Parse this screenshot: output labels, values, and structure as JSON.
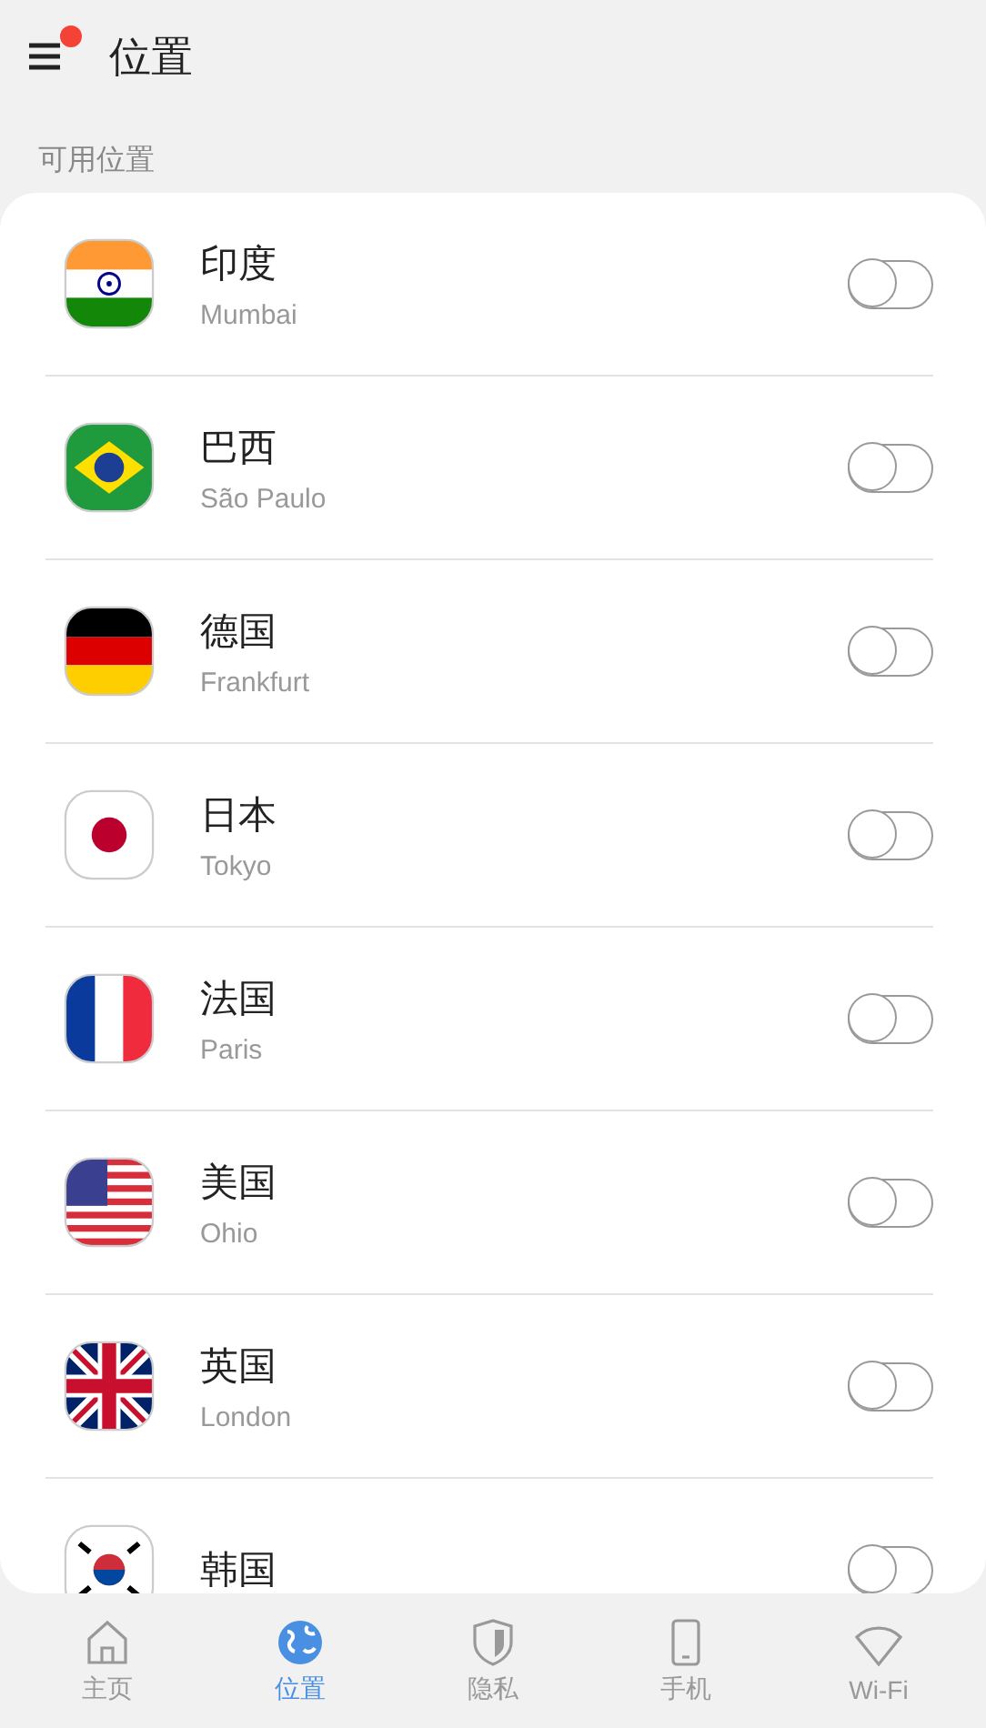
{
  "header": {
    "title": "位置",
    "menu_badge": true
  },
  "section_label": "可用位置",
  "locations": [
    {
      "country": "印度",
      "city": "Mumbai",
      "kind": "india",
      "on": false
    },
    {
      "country": "巴西",
      "city": "São Paulo",
      "kind": "brazil",
      "on": false
    },
    {
      "country": "德国",
      "city": "Frankfurt",
      "kind": "germany",
      "on": false
    },
    {
      "country": "日本",
      "city": "Tokyo",
      "kind": "japan",
      "on": false
    },
    {
      "country": "法国",
      "city": "Paris",
      "kind": "france",
      "on": false
    },
    {
      "country": "美国",
      "city": "Ohio",
      "kind": "usa",
      "on": false
    },
    {
      "country": "英国",
      "city": "London",
      "kind": "uk",
      "on": false
    },
    {
      "country": "韩国",
      "kind": "korea",
      "on": false
    }
  ],
  "nav": [
    {
      "label": "主页",
      "kind": "home",
      "selected": false
    },
    {
      "label": "位置",
      "kind": "globe",
      "selected": true
    },
    {
      "label": "隐私",
      "kind": "shield",
      "selected": false
    },
    {
      "label": "手机",
      "kind": "phone",
      "selected": false
    },
    {
      "label": "Wi-Fi",
      "kind": "wifi",
      "selected": false
    }
  ]
}
